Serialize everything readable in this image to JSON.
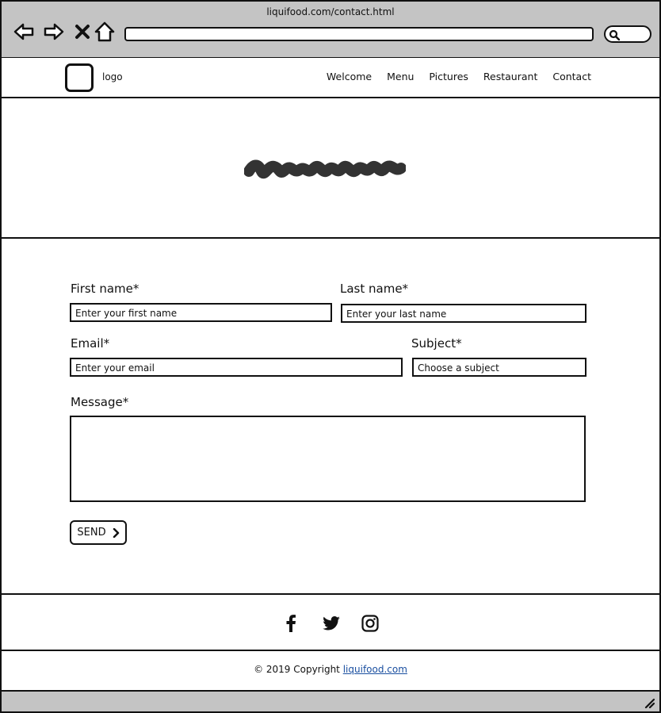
{
  "browser": {
    "url": "liquifood.com/contact.html",
    "icons": [
      "back-arrow-icon",
      "forward-arrow-icon",
      "close-x-icon",
      "home-icon",
      "search-icon"
    ]
  },
  "header": {
    "logo_label": "logo",
    "nav": [
      "Welcome",
      "Menu",
      "Pictures",
      "Restaurant",
      "Contact"
    ]
  },
  "form": {
    "first_name_label": "First name*",
    "first_name_placeholder": "Enter your first name",
    "last_name_label": "Last name*",
    "last_name_placeholder": "Enter your last name",
    "email_label": "Email*",
    "email_placeholder": "Enter your email",
    "subject_label": "Subject*",
    "subject_placeholder": "Choose a subject",
    "message_label": "Message*",
    "send_label": "SEND"
  },
  "social": {
    "icons": [
      "facebook-icon",
      "twitter-icon",
      "instagram-icon"
    ]
  },
  "footer": {
    "copyright_text": "© 2019 Copyright",
    "copyright_link": "liquifood.com"
  }
}
